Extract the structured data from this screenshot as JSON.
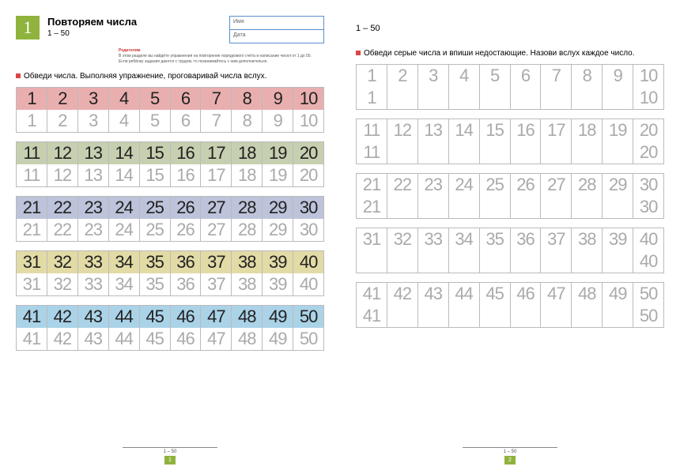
{
  "left": {
    "badge": "1",
    "title": "Повторяем числа",
    "range": "1 – 50",
    "form": {
      "name_label": "Имя",
      "date_label": "Дата"
    },
    "parents_label": "Родителям",
    "parents_text": "В этом разделе вы найдёте упражнения на повторение порядкового счёта и написание чисел от 1 до 50. Если ребёнку задания даются с трудом, то позанимайтесь с ним дополнительно.",
    "instruction": "Обведи числа. Выполняя упражнение, проговаривай числа вслух.",
    "groups": [
      {
        "color": "c-red",
        "top": [
          "1",
          "2",
          "3",
          "4",
          "5",
          "6",
          "7",
          "8",
          "9",
          "10"
        ],
        "bot": [
          "1",
          "2",
          "3",
          "4",
          "5",
          "6",
          "7",
          "8",
          "9",
          "10"
        ]
      },
      {
        "color": "c-green",
        "top": [
          "11",
          "12",
          "13",
          "14",
          "15",
          "16",
          "17",
          "18",
          "19",
          "20"
        ],
        "bot": [
          "11",
          "12",
          "13",
          "14",
          "15",
          "16",
          "17",
          "18",
          "19",
          "20"
        ]
      },
      {
        "color": "c-blue",
        "top": [
          "21",
          "22",
          "23",
          "24",
          "25",
          "26",
          "27",
          "28",
          "29",
          "30"
        ],
        "bot": [
          "21",
          "22",
          "23",
          "24",
          "25",
          "26",
          "27",
          "28",
          "29",
          "30"
        ]
      },
      {
        "color": "c-yel",
        "top": [
          "31",
          "32",
          "33",
          "34",
          "35",
          "36",
          "37",
          "38",
          "39",
          "40"
        ],
        "bot": [
          "31",
          "32",
          "33",
          "34",
          "35",
          "36",
          "37",
          "38",
          "39",
          "40"
        ]
      },
      {
        "color": "c-cyan",
        "top": [
          "41",
          "42",
          "43",
          "44",
          "45",
          "46",
          "47",
          "48",
          "49",
          "50"
        ],
        "bot": [
          "41",
          "42",
          "43",
          "44",
          "45",
          "46",
          "47",
          "48",
          "49",
          "50"
        ]
      }
    ],
    "footer_range": "1 – 50",
    "page_num": "1"
  },
  "right": {
    "range": "1 – 50",
    "instruction": "Обведи серые числа и впиши недостающие. Назови вслух каждое число.",
    "groups": [
      {
        "top": [
          "1",
          "2",
          "3",
          "4",
          "5",
          "6",
          "7",
          "8",
          "9",
          "10"
        ],
        "bot": [
          "1",
          "",
          "",
          "",
          "",
          "",
          "",
          "",
          "",
          "10"
        ]
      },
      {
        "top": [
          "11",
          "12",
          "13",
          "14",
          "15",
          "16",
          "17",
          "18",
          "19",
          "20"
        ],
        "bot": [
          "11",
          "",
          "",
          "",
          "",
          "",
          "",
          "",
          "",
          "20"
        ]
      },
      {
        "top": [
          "21",
          "22",
          "23",
          "24",
          "25",
          "26",
          "27",
          "28",
          "29",
          "30"
        ],
        "bot": [
          "21",
          "",
          "",
          "",
          "",
          "",
          "",
          "",
          "",
          "30"
        ]
      },
      {
        "top": [
          "31",
          "32",
          "33",
          "34",
          "35",
          "36",
          "37",
          "38",
          "39",
          "40"
        ],
        "bot": [
          "",
          "",
          "",
          "",
          "",
          "",
          "",
          "",
          "",
          "40"
        ]
      },
      {
        "top": [
          "41",
          "42",
          "43",
          "44",
          "45",
          "46",
          "47",
          "48",
          "49",
          "50"
        ],
        "bot": [
          "41",
          "",
          "",
          "",
          "",
          "",
          "",
          "",
          "",
          "50"
        ]
      }
    ],
    "footer_range": "1 – 50",
    "page_num": "2"
  }
}
